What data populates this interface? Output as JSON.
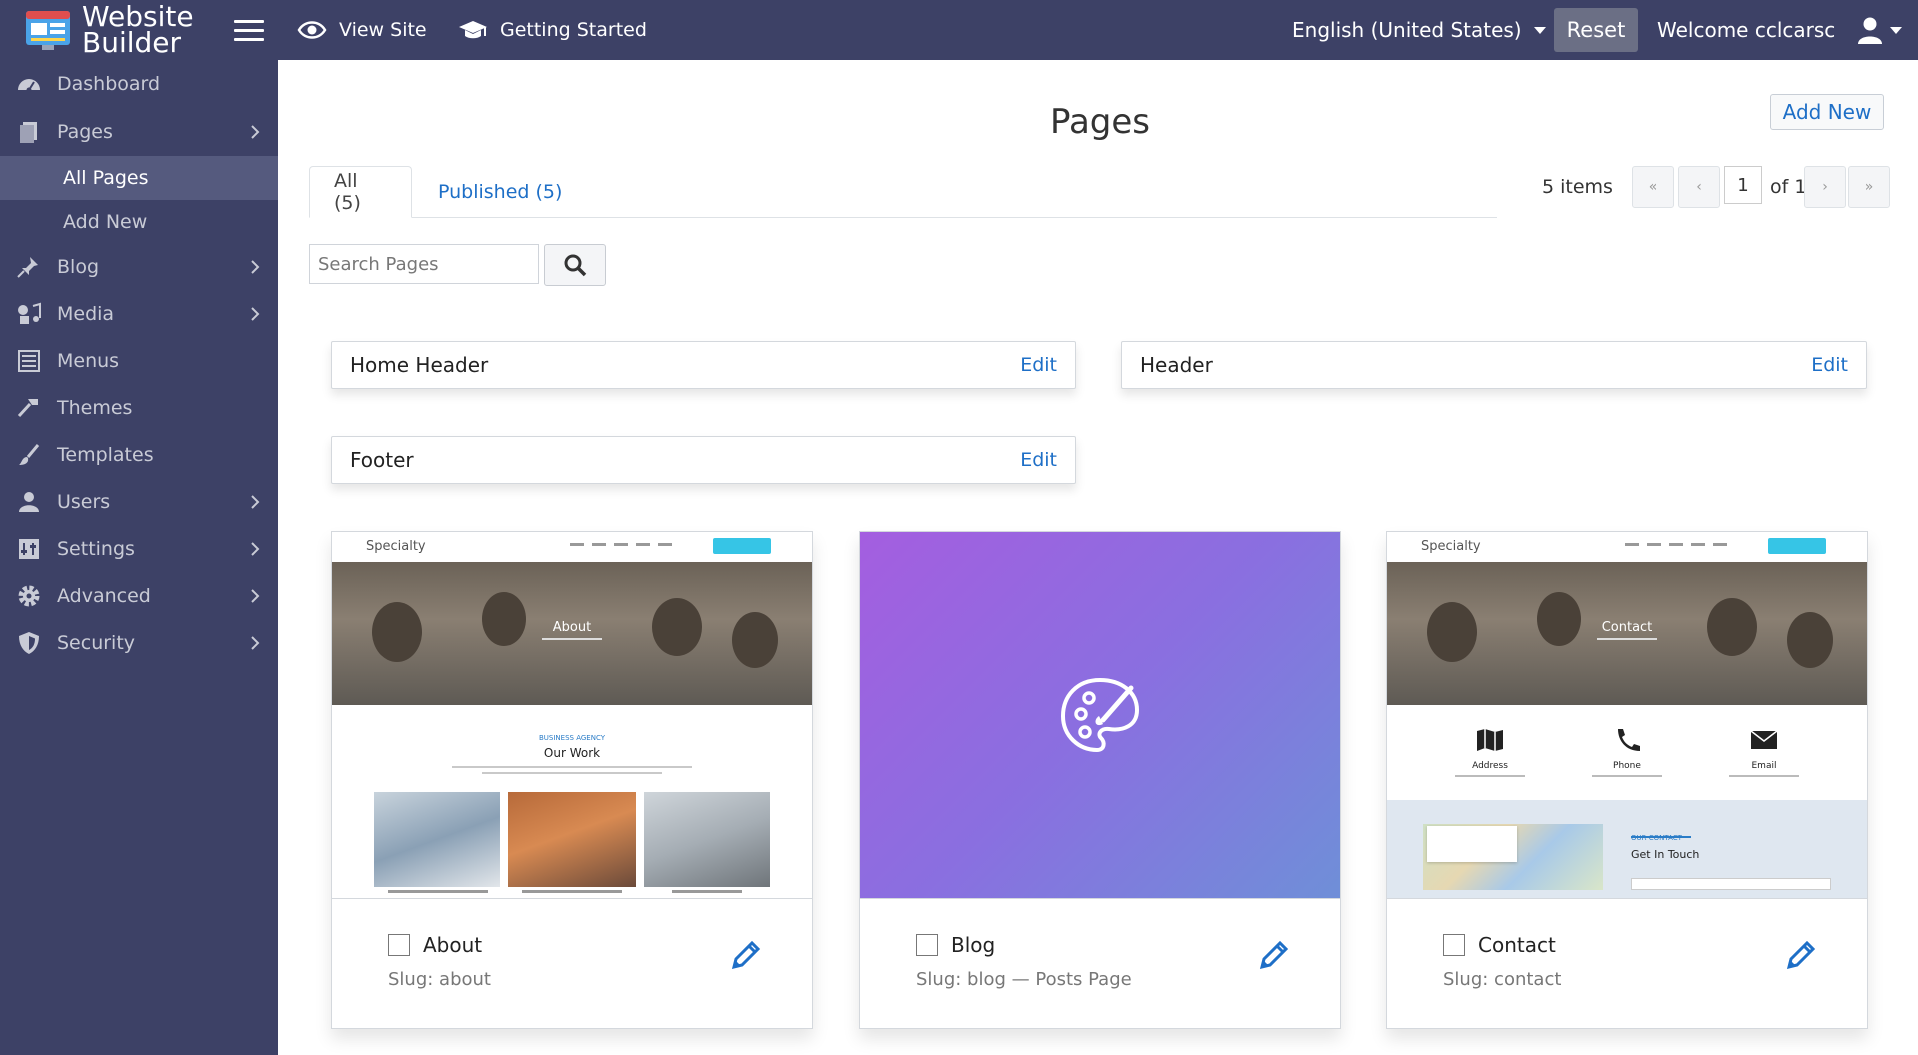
{
  "app": {
    "logo_line1": "Website",
    "logo_line2": "Builder"
  },
  "topbar": {
    "view_site": "View Site",
    "getting_started": "Getting Started",
    "language": "English (United States)",
    "reset": "Reset",
    "welcome": "Welcome cclcarsc"
  },
  "sidebar": {
    "items": [
      {
        "label": "Dashboard",
        "icon": "dashboard-icon",
        "expandable": false
      },
      {
        "label": "Pages",
        "icon": "pages-icon",
        "expandable": true
      },
      {
        "label": "Blog",
        "icon": "pin-icon",
        "expandable": true
      },
      {
        "label": "Media",
        "icon": "media-icon",
        "expandable": true
      },
      {
        "label": "Menus",
        "icon": "menu-list-icon",
        "expandable": false
      },
      {
        "label": "Themes",
        "icon": "hammer-icon",
        "expandable": false
      },
      {
        "label": "Templates",
        "icon": "brush-icon",
        "expandable": false
      },
      {
        "label": "Users",
        "icon": "user-icon",
        "expandable": true
      },
      {
        "label": "Settings",
        "icon": "settings-icon",
        "expandable": true
      },
      {
        "label": "Advanced",
        "icon": "gear-icon",
        "expandable": true
      },
      {
        "label": "Security",
        "icon": "shield-icon",
        "expandable": true
      }
    ],
    "pages_sub": {
      "all_pages": "All Pages",
      "add_new": "Add New"
    }
  },
  "main": {
    "title": "Pages",
    "add_new": "Add New",
    "tabs": [
      {
        "label": "All (5)"
      },
      {
        "label": "Published (5)"
      }
    ],
    "items_count": "5 items",
    "pagination": {
      "first": "«",
      "prev": "‹",
      "current": "1",
      "of": "of 1",
      "next": "›",
      "last": "»"
    },
    "search": {
      "placeholder": "Search Pages"
    },
    "sections": [
      {
        "name": "Home Header",
        "edit": "Edit"
      },
      {
        "name": "Header",
        "edit": "Edit"
      },
      {
        "name": "Footer",
        "edit": "Edit"
      }
    ],
    "cards": [
      {
        "title": "About",
        "slug": "Slug: about",
        "thumb": {
          "brand": "Specialty",
          "hero": "About",
          "eyebrow": "BUSINESS AGENCY",
          "heading": "Our Work"
        }
      },
      {
        "title": "Blog",
        "slug": "Slug: blog — Posts Page",
        "thumb": {
          "icon": "palette-icon"
        }
      },
      {
        "title": "Contact",
        "slug": "Slug: contact",
        "thumb": {
          "brand": "Specialty",
          "hero": "Contact",
          "address": "Address",
          "phone": "Phone",
          "email": "Email",
          "eyebrow": "OUR CONTACT",
          "heading": "Get In Touch"
        }
      }
    ]
  },
  "colors": {
    "topbar": "#3d4166",
    "sidebar_active": "#555a7e",
    "link": "#1e6fc7"
  }
}
